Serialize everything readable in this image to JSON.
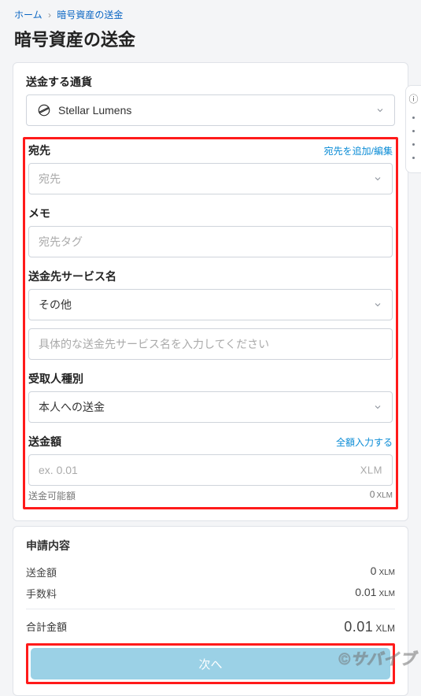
{
  "breadcrumb": {
    "home": "ホーム",
    "current": "暗号資産の送金"
  },
  "page_title": "暗号資産の送金",
  "currency": {
    "label": "送金する通貨",
    "selected": "Stellar Lumens",
    "icon_name": "stellar-icon"
  },
  "destination": {
    "label": "宛先",
    "action": "宛先を追加/編集",
    "placeholder": "宛先"
  },
  "memo": {
    "label": "メモ",
    "placeholder": "宛先タグ"
  },
  "service": {
    "label": "送金先サービス名",
    "selected": "その他",
    "detail_placeholder": "具体的な送金先サービス名を入力してください"
  },
  "recipient_type": {
    "label": "受取人種別",
    "selected": "本人への送金"
  },
  "amount": {
    "label": "送金額",
    "action": "全額入力する",
    "placeholder": "ex. 0.01",
    "suffix": "XLM",
    "available_label": "送金可能額",
    "available_value": "0",
    "available_unit": "XLM"
  },
  "summary": {
    "title": "申請内容",
    "rows": [
      {
        "label": "送金額",
        "value": "0",
        "unit": "XLM"
      },
      {
        "label": "手数料",
        "value": "0.01",
        "unit": "XLM"
      }
    ],
    "total": {
      "label": "合計金額",
      "value": "0.01",
      "unit": "XLM"
    }
  },
  "submit_label": "次へ",
  "watermark": "©サバイブ"
}
